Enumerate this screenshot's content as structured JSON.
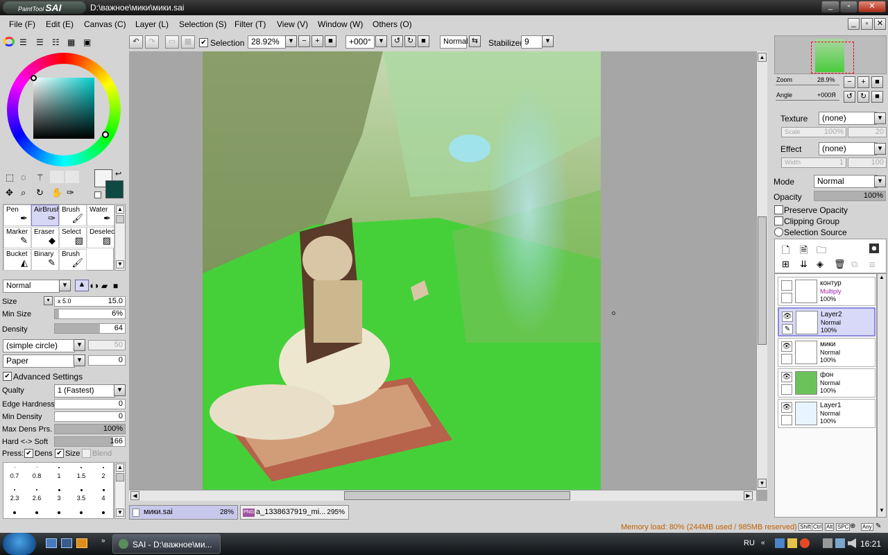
{
  "titlebar": {
    "app_name": "SAI",
    "app_prefix": "PaintTool",
    "path": "D:\\важное\\мики\\мики.sai",
    "buttons": [
      "_",
      "▫",
      "✕"
    ]
  },
  "menu": [
    "File (F)",
    "Edit (E)",
    "Canvas (C)",
    "Layer (L)",
    "Selection (S)",
    "Filter (T)",
    "View (V)",
    "Window (W)",
    "Others (O)"
  ],
  "toolbar": {
    "selection_label": "Selection",
    "selection_checked": true,
    "zoom": "28.92%",
    "angle": "+000°",
    "blend": "Normal",
    "stabilizer_label": "Stabilizer",
    "stabilizer": "9"
  },
  "tools": [
    {
      "label": "Pen",
      "icon": "pen-icon",
      "glyph": "✒"
    },
    {
      "label": "AirBrush",
      "icon": "airbrush-icon",
      "glyph": "✑",
      "selected": true
    },
    {
      "label": "Brush",
      "icon": "brush-icon",
      "glyph": "🖌"
    },
    {
      "label": "Water",
      "icon": "water-icon",
      "glyph": "✒"
    },
    {
      "label": "Marker",
      "icon": "marker-icon",
      "glyph": "✎"
    },
    {
      "label": "Eraser",
      "icon": "eraser-icon",
      "glyph": "◆"
    },
    {
      "label": "Select",
      "icon": "select-icon",
      "glyph": "▧"
    },
    {
      "label": "Deselect",
      "icon": "deselect-icon",
      "glyph": "▨"
    },
    {
      "label": "Bucket",
      "icon": "bucket-icon",
      "glyph": "◭"
    },
    {
      "label": "Binary",
      "icon": "binary-icon",
      "glyph": "✎"
    },
    {
      "label": "Brush",
      "icon": "brush-icon",
      "glyph": "🖌"
    }
  ],
  "brush": {
    "mode": "Normal",
    "size_label": "Size",
    "size_mult": "x 5.0",
    "size": "15.0",
    "minsize_label": "Min Size",
    "minsize": "6%",
    "minsize_fill": 0.06,
    "density_label": "Density",
    "density": "64",
    "density_fill": 0.64,
    "shape": "(simple circle)",
    "shape_val": "50",
    "texture": "Paper",
    "texture_val": "0",
    "advanced_label": "Advanced Settings",
    "quality_label": "Qualty",
    "quality": "1 (Fastest)",
    "edge_label": "Edge Hardness",
    "edge": "0",
    "mindens_label": "Min Density",
    "mindens": "0",
    "maxdens_label": "Max Dens Prs.",
    "maxdens": "100%",
    "hardsoft_label": "Hard <-> Soft",
    "hardsoft": "166",
    "hardsoft_fill": 0.83,
    "press_label": "Press:",
    "dens_label": "Dens",
    "size_chk_label": "Size",
    "blend_label": "Blend"
  },
  "brush_sizes": [
    "0.7",
    "0.8",
    "1",
    "1.5",
    "2",
    "2.3",
    "2.6",
    "3",
    "3.5",
    "4"
  ],
  "navigator": {
    "zoom_label": "Zoom",
    "zoom": "28.9%",
    "angle_label": "Angle",
    "angle": "+000Я"
  },
  "layerprops": {
    "texture_label": "Texture",
    "texture": "(none)",
    "scale_label": "Scale",
    "scale": "100%",
    "scale2": "20",
    "effect_label": "Effect",
    "effect": "(none)",
    "width_label": "Width",
    "width": "1",
    "width2": "100",
    "mode_label": "Mode",
    "mode": "Normal",
    "opacity_label": "Opacity",
    "opacity": "100%",
    "preserve": "Preserve Opacity",
    "clipping": "Clipping Group",
    "selsource": "Selection Source"
  },
  "layers": [
    {
      "name": "контур",
      "mode": "Multiply",
      "opacity": "100%",
      "visible": false,
      "selected": false
    },
    {
      "name": "Layer2",
      "mode": "Normal",
      "opacity": "100%",
      "visible": true,
      "selected": true
    },
    {
      "name": "мики",
      "mode": "Normal",
      "opacity": "100%",
      "visible": true,
      "selected": false
    },
    {
      "name": "фон",
      "mode": "Normal",
      "opacity": "100%",
      "visible": true,
      "selected": false
    },
    {
      "name": "Layer1",
      "mode": "Normal",
      "opacity": "100%",
      "visible": true,
      "selected": false
    }
  ],
  "doctabs": [
    {
      "name": "мики.sai",
      "zoom": "28%",
      "active": true
    },
    {
      "name": "a_1338637919_mi...",
      "zoom": "295%",
      "active": false,
      "badge": "PNG"
    }
  ],
  "status": {
    "memory": "Memory load: 80% (244MB used / 985MB reserved)",
    "keys": [
      "Shift",
      "Ctrl",
      "Alt",
      "SPC",
      "Any"
    ]
  },
  "taskbar": {
    "task": "SAI - D:\\важное\\ми...",
    "lang": "RU",
    "time": "16:21"
  },
  "colors": {
    "primary": "#f4f4f4",
    "secondary": "#0e4a42"
  }
}
